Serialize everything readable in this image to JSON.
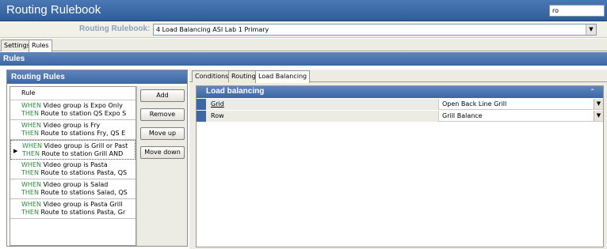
{
  "window": {
    "title": "Routing Rulebook",
    "search_value": "ro"
  },
  "rulebook": {
    "label": "Routing Rulebook:",
    "selected": "4 Load Balancing ASI Lab 1 Primary"
  },
  "top_tabs": [
    {
      "label": "Settings"
    },
    {
      "label": "Rules"
    }
  ],
  "section_title": "Rules",
  "routing_rules": {
    "title": "Routing Rules",
    "column_header": "Rule",
    "rules": [
      {
        "when": "WHEN",
        "when_text": " Video group is Expo Only",
        "then": "THEN",
        "then_text": " Route to station QS Expo S"
      },
      {
        "when": "WHEN",
        "when_text": " Video group is Fry",
        "then": "THEN",
        "then_text": " Route to stations Fry, QS E"
      },
      {
        "when": "WHEN",
        "when_text": " Video group is Grill or Past",
        "then": "THEN",
        "then_text": " Route to station Grill  AND"
      },
      {
        "when": "WHEN",
        "when_text": " Video group is Pasta",
        "then": "THEN",
        "then_text": " Route to stations Pasta, QS"
      },
      {
        "when": "WHEN",
        "when_text": " Video group is Salad",
        "then": "THEN",
        "then_text": " Route to stations Salad, QS"
      },
      {
        "when": "WHEN",
        "when_text": " Video group is Pasta Grill",
        "then": "THEN",
        "then_text": " Route to stations Pasta, Gr"
      }
    ],
    "buttons": {
      "add": "Add",
      "remove": "Remove",
      "move_up": "Move up",
      "move_down": "Move down"
    }
  },
  "sub_tabs": [
    {
      "label": "Conditions"
    },
    {
      "label": "Routing"
    },
    {
      "label": "Load Balancing"
    }
  ],
  "load_balancing": {
    "title": "Load balancing",
    "rows": [
      {
        "name": "Grid",
        "value": "Open Back Line Grill"
      },
      {
        "name": "Row",
        "value": "Grill Balance"
      }
    ]
  },
  "colors": {
    "accent": "#3c67a4",
    "when_then": "#2b8a3a"
  }
}
